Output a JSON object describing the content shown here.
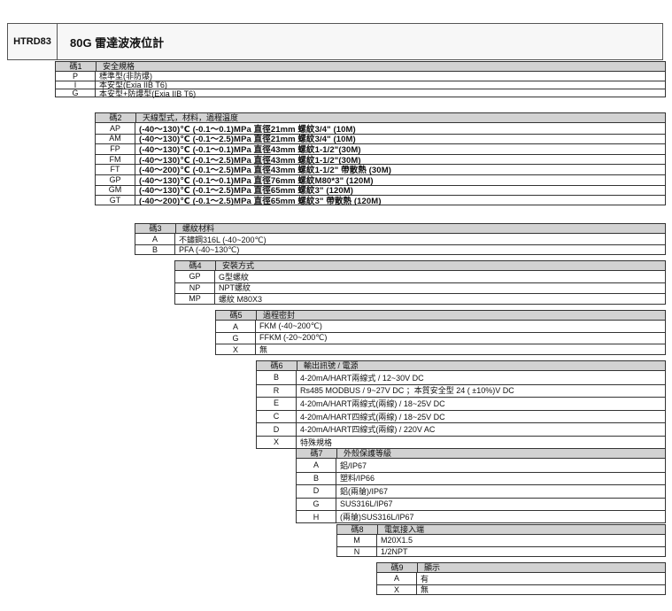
{
  "header": {
    "model": "HTRD83",
    "title": "80G 雷達波液位計"
  },
  "sections": [
    {
      "code_label": "碼1",
      "name": "安全規格",
      "rows": [
        {
          "code": "P",
          "desc": "標準型(非防爆)"
        },
        {
          "code": "I",
          "desc": "本安型(Exia IIB T6)"
        },
        {
          "code": "G",
          "desc": "本安型+防爆型(Exia IIB T6)"
        }
      ]
    },
    {
      "code_label": "碼2",
      "name": "天線型式，材料，過程溫度",
      "rows": [
        {
          "code": "AP",
          "desc": "(-40～130)℃  (-0.1～0.1)MPa  直徑21mm  螺紋3/4\"   (10M)"
        },
        {
          "code": "AM",
          "desc": "(-40～130)℃  (-0.1～2.5)MPa  直徑21mm  螺紋3/4\"   (10M)"
        },
        {
          "code": "FP",
          "desc": "(-40～130)℃  (-0.1～0.1)MPa  直徑43mm  螺紋1-1/2\"(30M)"
        },
        {
          "code": "FM",
          "desc": "(-40～130)℃  (-0.1～2.5)MPa  直徑43mm  螺紋1-1/2\"(30M)"
        },
        {
          "code": "FT",
          "desc": "(-40～200)℃  (-0.1～2.5)MPa  直徑43mm  螺紋1-1/2\"  帶散熱 (30M)"
        },
        {
          "code": "GP",
          "desc": "(-40～130)℃  (-0.1～0.1)MPa  直徑76mm  螺紋M80*3\"   (120M)"
        },
        {
          "code": "GM",
          "desc": "(-40～130)℃  (-0.1～2.5)MPa  直徑65mm  螺紋3\"          (120M)"
        },
        {
          "code": "GT",
          "desc": "(-40～200)℃  (-0.1～2.5)MPa  直徑65mm  螺紋3\"  帶散熱 (120M)"
        }
      ]
    },
    {
      "code_label": "碼3",
      "name": "螺紋材料",
      "rows": [
        {
          "code": "A",
          "desc": "不鏽鋼316L (-40~200℃)"
        },
        {
          "code": "B",
          "desc": "PFA (-40~130℃)"
        }
      ]
    },
    {
      "code_label": "碼4",
      "name": "安裝方式",
      "rows": [
        {
          "code": "GP",
          "desc": "G型螺紋"
        },
        {
          "code": "NP",
          "desc": "NPT螺紋"
        },
        {
          "code": "MP",
          "desc": "螺紋 M80X3"
        }
      ]
    },
    {
      "code_label": "碼5",
      "name": "過程密封",
      "rows": [
        {
          "code": "A",
          "desc": "FKM (-40~200℃)"
        },
        {
          "code": "G",
          "desc": "FFKM (-20~200℃)"
        },
        {
          "code": "X",
          "desc": "無"
        }
      ]
    },
    {
      "code_label": "碼6",
      "name": "輸出訊號 / 電源",
      "rows": [
        {
          "code": "B",
          "desc": "4-20mA/HART兩線式 / 12~30V DC"
        },
        {
          "code": "R",
          "desc": "Rs485 MODBUS / 9~27V DC ；本質安全型 24 ( ±10%)V DC"
        },
        {
          "code": "E",
          "desc": "4-20mA/HART兩線式(兩線) / 18~25V DC"
        },
        {
          "code": "C",
          "desc": "4-20mA/HART四線式(兩線) / 18~25V DC"
        },
        {
          "code": "D",
          "desc": "4-20mA/HART四線式(兩線) /  220V AC"
        },
        {
          "code": "X",
          "desc": "特殊規格"
        }
      ]
    },
    {
      "code_label": "碼7",
      "name": "外殼保護等級",
      "rows": [
        {
          "code": "A",
          "desc": "鋁/IP67"
        },
        {
          "code": "B",
          "desc": "塑料/IP66"
        },
        {
          "code": "D",
          "desc": "鋁(兩艙)/IP67"
        },
        {
          "code": "G",
          "desc": "SUS316L/IP67"
        },
        {
          "code": "H",
          "desc": "(兩艙)SUS316L/IP67"
        }
      ]
    },
    {
      "code_label": "碼8",
      "name": "電氣接入端",
      "rows": [
        {
          "code": "M",
          "desc": "M20X1.5"
        },
        {
          "code": "N",
          "desc": "1/2NPT"
        }
      ]
    },
    {
      "code_label": "碼9",
      "name": "顯示",
      "rows": [
        {
          "code": "A",
          "desc": "有"
        },
        {
          "code": "X",
          "desc": "無"
        }
      ]
    }
  ]
}
